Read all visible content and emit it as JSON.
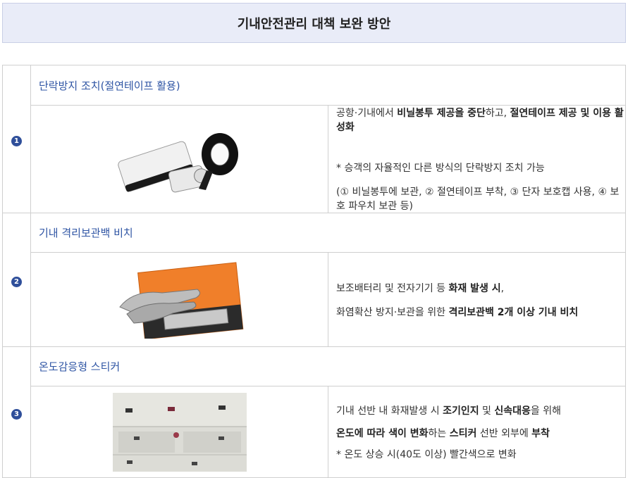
{
  "title": "기내안전관리 대책 보완 방안",
  "items": [
    {
      "number": "❶",
      "heading": "단락방지 조치(절연테이프 활용)",
      "image_subject": "battery-and-insulating-tape",
      "line1": [
        {
          "t": "공항·기내에서 ",
          "b": false
        },
        {
          "t": "비닐봉투 제공을 중단",
          "b": true
        },
        {
          "t": "하고, ",
          "b": false
        },
        {
          "t": "절연테이프 제공 및 이용 활성화",
          "b": true
        }
      ],
      "line2": "* 승객의 자율적인 다른 방식의 단락방지 조치 가능",
      "line3": "(① 비닐봉투에 보관, ② 절연테이프 부착, ③ 단자 보호캡 사용, ④ 보호 파우치 보관 등)"
    },
    {
      "number": "❷",
      "heading": "기내 격리보관백 비치",
      "image_subject": "fire-containment-bag-with-gloves",
      "line1": [
        {
          "t": "보조배터리 및 전자기기 등 ",
          "b": false
        },
        {
          "t": "화재 발생 시",
          "b": true
        },
        {
          "t": ",",
          "b": false
        }
      ],
      "line2": [
        {
          "t": "화염확산 방지·보관을 위한 ",
          "b": false
        },
        {
          "t": "격리보관백 2개 이상 기내 비치",
          "b": true
        }
      ]
    },
    {
      "number": "❸",
      "heading": "온도감응형 스티커",
      "image_subject": "overhead-bin-with-stickers",
      "line1": [
        {
          "t": "기내 선반 내 화재발생 시 ",
          "b": false
        },
        {
          "t": "조기인지",
          "b": true
        },
        {
          "t": " 및 ",
          "b": false
        },
        {
          "t": "신속대응",
          "b": true
        },
        {
          "t": "을 위해",
          "b": false
        }
      ],
      "line2": [
        {
          "t": "온도에 따라 색이 변화",
          "b": true
        },
        {
          "t": "하는 ",
          "b": false
        },
        {
          "t": "스티커",
          "b": true
        },
        {
          "t": " 선반 외부에 ",
          "b": false
        },
        {
          "t": "부착",
          "b": true
        }
      ],
      "line3": "* 온도 상승 시(40도 이상) 빨간색으로 변화"
    }
  ]
}
